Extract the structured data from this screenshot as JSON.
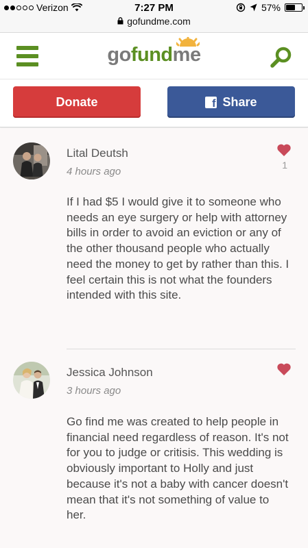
{
  "status_bar": {
    "carrier": "Verizon",
    "time": "7:27 PM",
    "battery": "57%",
    "battery_level": 0.57
  },
  "browser": {
    "url": "gofundme.com"
  },
  "header": {
    "logo_part1": "go",
    "logo_part2": "fund",
    "logo_part3": "me"
  },
  "actions": {
    "donate_label": "Donate",
    "share_label": "Share"
  },
  "colors": {
    "brand_green": "#5b8f22",
    "donate_red": "#d63c3c",
    "facebook_blue": "#3b5998",
    "heart_red": "#c94a5a"
  },
  "comments": [
    {
      "name": "Lital Deutsh",
      "time": "4 hours ago",
      "likes": "1",
      "text": "If I had $5 I would give it to someone who needs an eye surgery or help with attorney bills in order to avoid an eviction or any of the other thousand people who actually need the money to get by rather than this. I feel certain this is not what the founders intended with this site."
    },
    {
      "name": "Jessica Johnson",
      "time": "3 hours ago",
      "likes": "",
      "text": "Go find me was created to help people in financial need regardless of reason. It's not for you to judge or critisis. This wedding is obviously important to Holly and just because it's not a baby with cancer doesn't mean that it's not something of value to her."
    }
  ]
}
